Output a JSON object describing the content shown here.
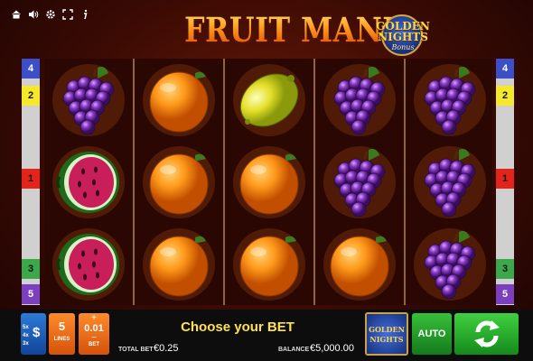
{
  "title": "FRUIT MANIA",
  "golden_nights_logo": {
    "line1": "GOLDEN",
    "line2": "NIGHTS",
    "line3": "Bonus"
  },
  "top_icons": [
    "home-icon",
    "sound-icon",
    "settings-icon",
    "fullscreen-icon",
    "info-icon"
  ],
  "paylines_left": [
    {
      "number": "4",
      "color": "#3c4ec8",
      "text": "#ffffff"
    },
    {
      "number": "2",
      "color": "#f6e829",
      "text": "#111111"
    },
    {
      "number": "1",
      "color": "#e4231b",
      "text": "#111111"
    },
    {
      "number": "3",
      "color": "#3ba84a",
      "text": "#111111"
    },
    {
      "number": "5",
      "color": "#7b3fbf",
      "text": "#ffffff"
    }
  ],
  "paylines_right": [
    {
      "number": "4",
      "color": "#3c4ec8",
      "text": "#ffffff"
    },
    {
      "number": "2",
      "color": "#f6e829",
      "text": "#111111"
    },
    {
      "number": "1",
      "color": "#e4231b",
      "text": "#111111"
    },
    {
      "number": "3",
      "color": "#3ba84a",
      "text": "#111111"
    },
    {
      "number": "5",
      "color": "#7b3fbf",
      "text": "#ffffff"
    }
  ],
  "reels": [
    [
      "grapes",
      "watermelon",
      "watermelon"
    ],
    [
      "orange",
      "orange",
      "orange"
    ],
    [
      "lemon",
      "orange",
      "orange"
    ],
    [
      "grapes",
      "grapes",
      "orange"
    ],
    [
      "grapes",
      "grapes",
      "grapes"
    ]
  ],
  "bottom_bar": {
    "lines_button_rows": [
      "5x",
      "4x",
      "3x"
    ],
    "lines_button_symbol": "$",
    "lines_value": "5",
    "lines_label": "LINES",
    "bet_plus": "+",
    "bet_value": "0.01",
    "bet_minus": "−",
    "bet_label": "BET",
    "message": "Choose your BET",
    "total_bet_label": "TOTAL BET",
    "total_bet_value": "€0.25",
    "balance_label": "BALANCE",
    "balance_value": "€5,000.00",
    "golden_nights_line1": "GOLDEN",
    "golden_nights_line2": "NIGHTS",
    "auto_label": "AUTO"
  },
  "colors": {
    "accent_orange": "#ff8a2a",
    "spin_green": "#2ab42f",
    "message_yellow": "#ffe24a"
  }
}
